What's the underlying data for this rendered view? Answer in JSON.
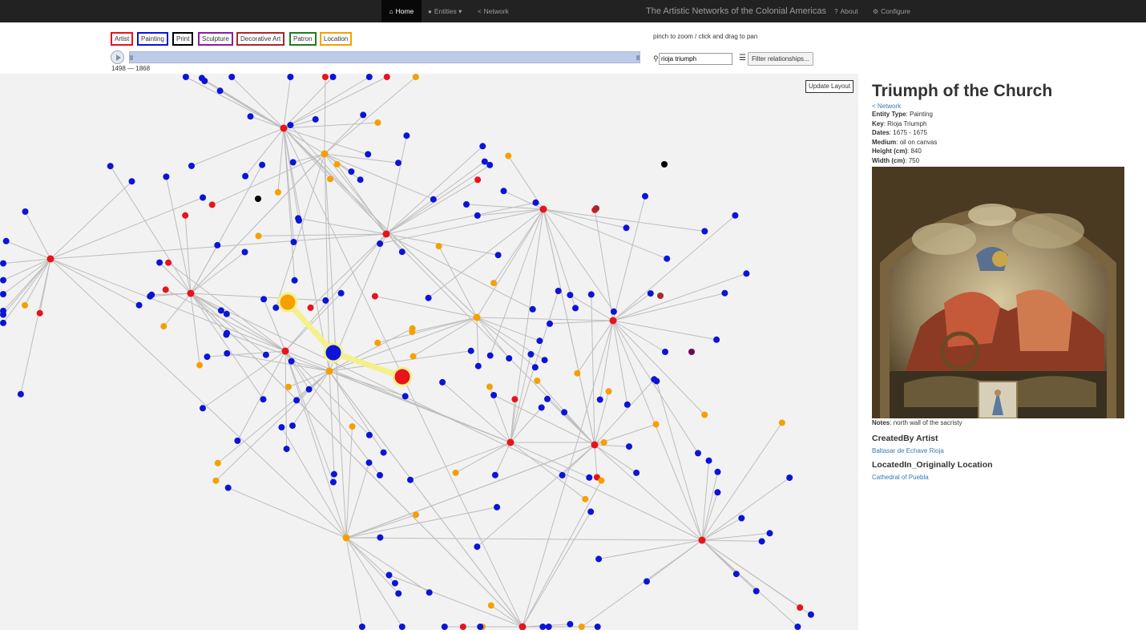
{
  "nav": {
    "home": "Home",
    "entities": "Entities",
    "network": "Network",
    "title": "The Artistic Networks of the Colonial Americas",
    "about": "About",
    "configure": "Configure"
  },
  "legend": [
    {
      "label": "Artist",
      "color": "#e8131b"
    },
    {
      "label": "Painting",
      "color": "#0c14d8"
    },
    {
      "label": "Print",
      "color": "#000000"
    },
    {
      "label": "Sculpture",
      "color": "#8a1ca0"
    },
    {
      "label": "Decorative Art",
      "color": "#a52a2a"
    },
    {
      "label": "Patron",
      "color": "#1a7f1a"
    },
    {
      "label": "Location",
      "color": "#f5a000"
    }
  ],
  "timeline": {
    "range": "1498 — 1868"
  },
  "hint": "pinch to zoom / click and drag to pan",
  "search": {
    "value": "rioja triumph"
  },
  "filter_label": "Filter relationships...",
  "update_label": "Update Layout",
  "detail": {
    "title": "Triumph of the Church",
    "network_link": "Network",
    "rows": [
      {
        "key": "Entity Type",
        "value": "Painting"
      },
      {
        "key": "Key",
        "value": "Rioja Triumph"
      },
      {
        "key": "Dates",
        "value": "1675 - 1675"
      },
      {
        "key": "Medium",
        "value": "oil on canvas"
      },
      {
        "key": "Height (cm)",
        "value": "840"
      },
      {
        "key": "Width (cm)",
        "value": "750"
      }
    ],
    "notes_label": "Notes",
    "notes": "north wall of the sacristy",
    "created_heading": "CreatedBy Artist",
    "created_link": "Baltasar de Echave Rioja",
    "located_heading": "LocatedIn_Originally Location",
    "located_link": "Cathedral of Puebla"
  },
  "colors": {
    "artist": "#e8131b",
    "painting": "#0c14d8",
    "location": "#f5a000",
    "print": "#000000",
    "decorative": "#a52a2a",
    "sculpture": "#6a0a5a",
    "highlight_edge": "#f4f08a"
  }
}
